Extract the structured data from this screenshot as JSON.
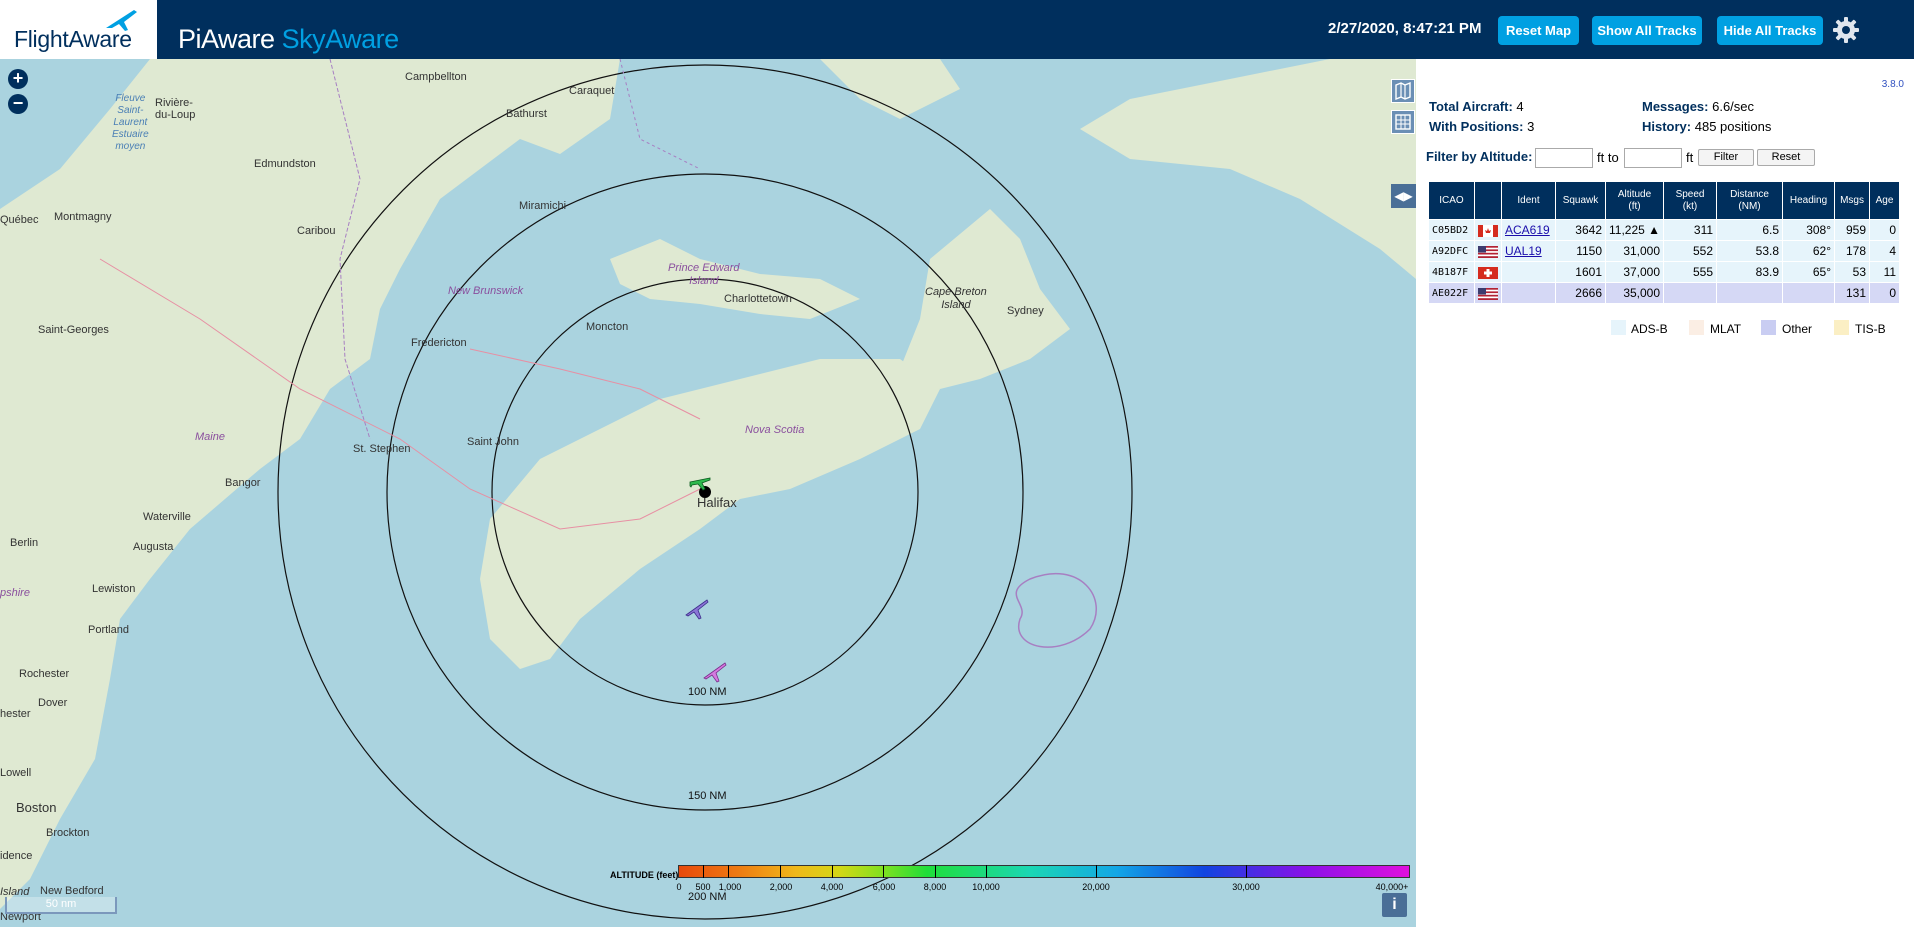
{
  "header": {
    "brand_flight": "FlightAware",
    "app_name_part1": "PiAware",
    "app_name_part2": "SkyAware",
    "clock": "2/27/2020, 8:47:21 PM",
    "reset_map": "Reset Map",
    "show_all_tracks": "Show All Tracks",
    "hide_all_tracks": "Hide All Tracks",
    "settings_icon": "gear-icon"
  },
  "map": {
    "zoom_in": "+",
    "zoom_out": "−",
    "scale_label": "50 nm",
    "info_label": "i",
    "range_rings": [
      "100 NM",
      "150 NM",
      "200 NM"
    ],
    "cities": [
      {
        "name": "Campbellton"
      },
      {
        "name": "Caraquet"
      },
      {
        "name": "Bathurst"
      },
      {
        "name": "Rivière-\ndu-Loup"
      },
      {
        "name": "Edmundston"
      },
      {
        "name": "Québec"
      },
      {
        "name": "Montmagny"
      },
      {
        "name": "Caribou"
      },
      {
        "name": "Miramichi"
      },
      {
        "name": "Charlottetown"
      },
      {
        "name": "Moncton"
      },
      {
        "name": "Fredericton"
      },
      {
        "name": "Saint-Georges"
      },
      {
        "name": "Saint John"
      },
      {
        "name": "St. Stephen"
      },
      {
        "name": "Bangor"
      },
      {
        "name": "Waterville"
      },
      {
        "name": "Augusta"
      },
      {
        "name": "Berlin"
      },
      {
        "name": "Lewiston"
      },
      {
        "name": "Portland"
      },
      {
        "name": "Rochester"
      },
      {
        "name": "Dover"
      },
      {
        "name": "Boston"
      },
      {
        "name": "Brockton"
      },
      {
        "name": "New Bedford"
      },
      {
        "name": "Halifax"
      },
      {
        "name": "Sydney"
      },
      {
        "name": "Lowell"
      },
      {
        "name": "hester"
      },
      {
        "name": "idence"
      },
      {
        "name": "Island"
      },
      {
        "name": "Newport"
      },
      {
        "name": "pshire"
      }
    ],
    "regions": [
      {
        "name": "New Brunswick"
      },
      {
        "name": "Prince Edward\nIsland"
      },
      {
        "name": "Nova Scotia"
      },
      {
        "name": "Maine"
      },
      {
        "name": "Cape Breton\nIsland"
      }
    ],
    "water": [
      {
        "name": "Fleuve\nSaint-\nLaurent\nEstuaire\nmoyen"
      }
    ]
  },
  "altitude_legend": {
    "title": "ALTITUDE (feet)",
    "labels": [
      "0",
      "500",
      "1,000",
      "2,000",
      "4,000",
      "6,000",
      "8,000",
      "10,000",
      "20,000",
      "30,000",
      "40,000+"
    ]
  },
  "panel": {
    "version": "3.8.0",
    "total_aircraft_label": "Total Aircraft:",
    "total_aircraft_value": "4",
    "with_positions_label": "With Positions:",
    "with_positions_value": "3",
    "messages_label": "Messages:",
    "messages_value": "6.6/sec",
    "history_label": "History:",
    "history_value": "485 positions",
    "filter_label": "Filter by Altitude:",
    "filter_to": "ft to",
    "filter_ft": "ft",
    "filter_min_value": "",
    "filter_max_value": "",
    "filter_button": "Filter",
    "reset_button": "Reset",
    "columns": [
      "ICAO",
      "",
      "Ident",
      "Squawk",
      "Altitude\n(ft)",
      "Speed\n(kt)",
      "Distance\n(NM)",
      "Heading",
      "Msgs",
      "Age"
    ],
    "rows": [
      {
        "icao": "C05BD2",
        "flag": "ca",
        "ident": "ACA619",
        "squawk": "3642",
        "altitude": "11,225 ▲",
        "speed": "311",
        "distance": "6.5",
        "heading": "308°",
        "msgs": "959",
        "age": "0",
        "source": "adsb"
      },
      {
        "icao": "A92DFC",
        "flag": "us",
        "ident": "UAL19",
        "squawk": "1150",
        "altitude": "31,000",
        "speed": "552",
        "distance": "53.8",
        "heading": "62°",
        "msgs": "178",
        "age": "4",
        "source": "adsb"
      },
      {
        "icao": "4B187F",
        "flag": "ch",
        "ident": "",
        "squawk": "1601",
        "altitude": "37,000",
        "speed": "555",
        "distance": "83.9",
        "heading": "65°",
        "msgs": "53",
        "age": "11",
        "source": "adsb"
      },
      {
        "icao": "AE022F",
        "flag": "us",
        "ident": "",
        "squawk": "2666",
        "altitude": "35,000",
        "speed": "",
        "distance": "",
        "heading": "",
        "msgs": "131",
        "age": "0",
        "source": "other"
      }
    ],
    "legend": [
      {
        "label": "ADS-B",
        "color": "#e6f4fb"
      },
      {
        "label": "MLAT",
        "color": "#fbeee4"
      },
      {
        "label": "Other",
        "color": "#c9cdf2"
      },
      {
        "label": "TIS-B",
        "color": "#fbefc4"
      }
    ]
  },
  "colors": {
    "header_bg": "#002f5d",
    "button_bg": "#00a0e2",
    "water": "#aad3df",
    "land": "#dfe9d2"
  }
}
